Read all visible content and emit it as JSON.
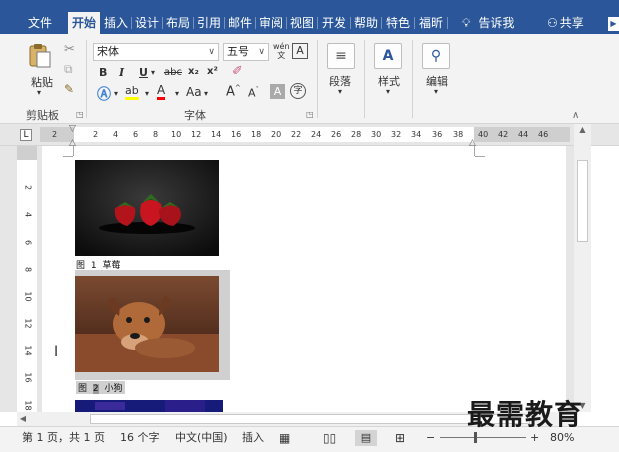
{
  "tabs": [
    {
      "label": "文件"
    },
    {
      "label": "开始"
    },
    {
      "label": "插入"
    },
    {
      "label": "设计"
    },
    {
      "label": "布局"
    },
    {
      "label": "引用"
    },
    {
      "label": "邮件"
    },
    {
      "label": "审阅"
    },
    {
      "label": "视图"
    },
    {
      "label": "开发"
    },
    {
      "label": "帮助"
    },
    {
      "label": "特色"
    },
    {
      "label": "福昕"
    }
  ],
  "active_tab": "开始",
  "tell_me": "告诉我",
  "share": "共享",
  "ribbon": {
    "clipboard": {
      "paste": "粘贴",
      "group_label": "剪贴板"
    },
    "font": {
      "font_name": "宋体",
      "font_size": "五号",
      "group_label": "字体",
      "bold": "B",
      "italic": "I",
      "underline": "U",
      "strike": "abc",
      "sub": "x₂",
      "sup": "x²",
      "case": "Aa",
      "grow": "A",
      "shrink": "A",
      "phonetic": "wén",
      "border": "A"
    },
    "paragraph": {
      "label": "段落"
    },
    "styles": {
      "label": "样式"
    },
    "editing": {
      "label": "编辑"
    }
  },
  "ruler": {
    "ticks": [
      "2",
      "2",
      "4",
      "6",
      "8",
      "10",
      "12",
      "14",
      "16",
      "18",
      "20",
      "22",
      "24",
      "26",
      "28",
      "30",
      "32",
      "34",
      "36",
      "38",
      "40",
      "42",
      "44",
      "46"
    ],
    "vticks": [
      "2",
      "4",
      "6",
      "8",
      "10",
      "12",
      "14",
      "16",
      "18"
    ]
  },
  "document": {
    "captions": [
      {
        "label": "图",
        "number": "1",
        "text": "草莓"
      },
      {
        "label": "图",
        "number": "2",
        "text": "小狗"
      }
    ]
  },
  "statusbar": {
    "pages": "第 1 页，共 1 页",
    "words": "16 个字",
    "language": "中文(中国)",
    "mode": "插入",
    "zoom": "80%",
    "zoom_minus": "−",
    "zoom_plus": "+"
  },
  "watermark": "最需教育",
  "colors": {
    "accent": "#2b579a",
    "ribbon_bg": "#f3f3f3",
    "highlight": "#ffff00",
    "font_color": "#ff0000"
  }
}
